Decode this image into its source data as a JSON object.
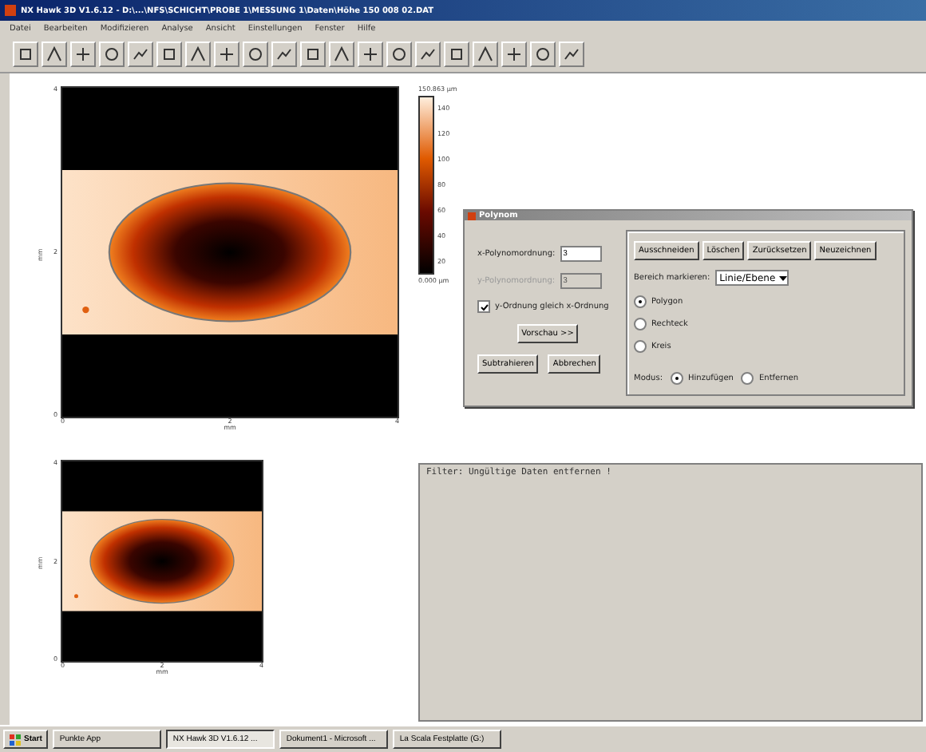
{
  "window": {
    "title": "NX Hawk 3D V1.6.12 - D:\\...\\NFS\\SCHICHT\\PROBE 1\\MESSUNG 1\\Daten\\Höhe 150 008 02.DAT"
  },
  "menu": [
    "Datei",
    "Bearbeiten",
    "Modifizieren",
    "Analyse",
    "Ansicht",
    "Einstellungen",
    "Fenster",
    "Hilfe"
  ],
  "plots": [
    {
      "kind": "main",
      "y_label": "mm",
      "x_label": "mm",
      "y_ticks": [
        "4",
        "2",
        "0"
      ],
      "x_ticks": [
        "0",
        "2",
        "4"
      ],
      "colorbar": {
        "max": "150.863 µm",
        "ticks": [
          "140",
          "120",
          "100",
          "80",
          "60",
          "40",
          "20"
        ],
        "min": "0.000 µm"
      }
    },
    {
      "kind": "preview",
      "y_label": "mm",
      "x_label": "mm",
      "y_ticks": [
        "4",
        "2",
        "0"
      ],
      "x_ticks": [
        "0",
        "2",
        "4"
      ]
    }
  ],
  "dialog": {
    "title": "Polynom",
    "x_order": {
      "label": "x-Polynomordnung:",
      "value": "3",
      "disabled": false
    },
    "y_order": {
      "label": "y-Polynomordnung:",
      "value": "3",
      "disabled": true
    },
    "same_order": {
      "label": "y-Ordnung gleich x-Ordnung",
      "checked": true
    },
    "preview_button": "Vorschau >>",
    "buttons": [
      "Subtrahieren",
      "Abbrechen"
    ],
    "tool_buttons": [
      "Ausschneiden",
      "Löschen",
      "Zurücksetzen",
      "Neuzeichnen"
    ],
    "region": {
      "label": "Bereich markieren:",
      "value": "Linie/Ebene"
    },
    "shapes": [
      {
        "label": "Polygon",
        "selected": true
      },
      {
        "label": "Rechteck",
        "selected": false
      },
      {
        "label": "Kreis",
        "selected": false
      }
    ],
    "mode": {
      "label": "Modus:",
      "options": [
        {
          "label": "Hinzufügen",
          "selected": true
        },
        {
          "label": "Entfernen",
          "selected": false
        }
      ]
    }
  },
  "console": {
    "text": "Filter: Ungültige Daten entfernen !"
  },
  "taskbar": {
    "start": "Start",
    "tasks": [
      {
        "label": "Punkte App",
        "selected": false
      },
      {
        "label": "NX Hawk 3D V1.6.12 ...",
        "selected": true
      },
      {
        "label": "Dokument1 - Microsoft ...",
        "selected": false
      },
      {
        "label": "La Scala Festplatte (G:)",
        "selected": false
      }
    ]
  }
}
